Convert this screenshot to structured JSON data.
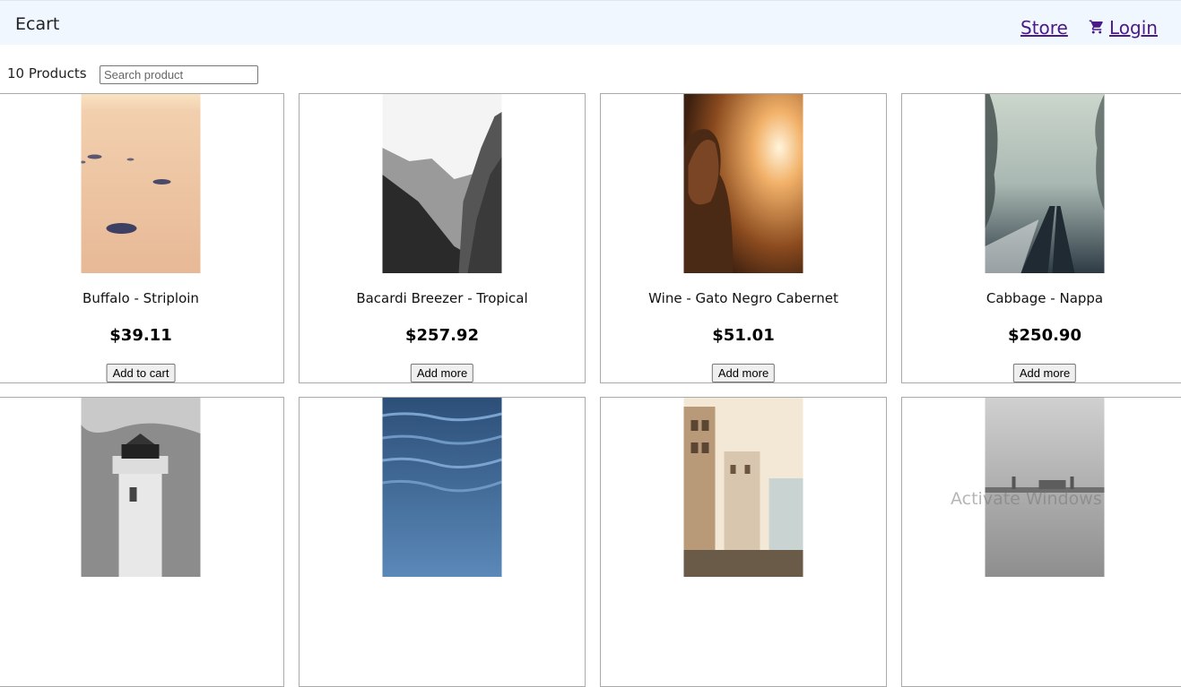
{
  "header": {
    "brand": "Ecart",
    "store_label": "Store",
    "login_label": "Login",
    "cart_icon": "cart-icon"
  },
  "toolbar": {
    "count_label": "10 Products",
    "search_placeholder": "Search product",
    "search_value": ""
  },
  "products": [
    {
      "name": "Buffalo - Striploin",
      "price": "$39.11",
      "button": "Add to cart"
    },
    {
      "name": "Bacardi Breezer - Tropical",
      "price": "$257.92",
      "button": "Add more"
    },
    {
      "name": "Wine - Gato Negro Cabernet",
      "price": "$51.01",
      "button": "Add more"
    },
    {
      "name": "Cabbage - Nappa",
      "price": "$250.90",
      "button": "Add more"
    },
    {
      "name": "",
      "price": "",
      "button": ""
    },
    {
      "name": "",
      "price": "",
      "button": ""
    },
    {
      "name": "",
      "price": "",
      "button": ""
    },
    {
      "name": "",
      "price": "",
      "button": ""
    }
  ],
  "watermark": "Activate Windows",
  "colors": {
    "navbar_bg": "#f0f7ff",
    "link": "#4b1a87",
    "card_border": "#a9a9a9"
  }
}
